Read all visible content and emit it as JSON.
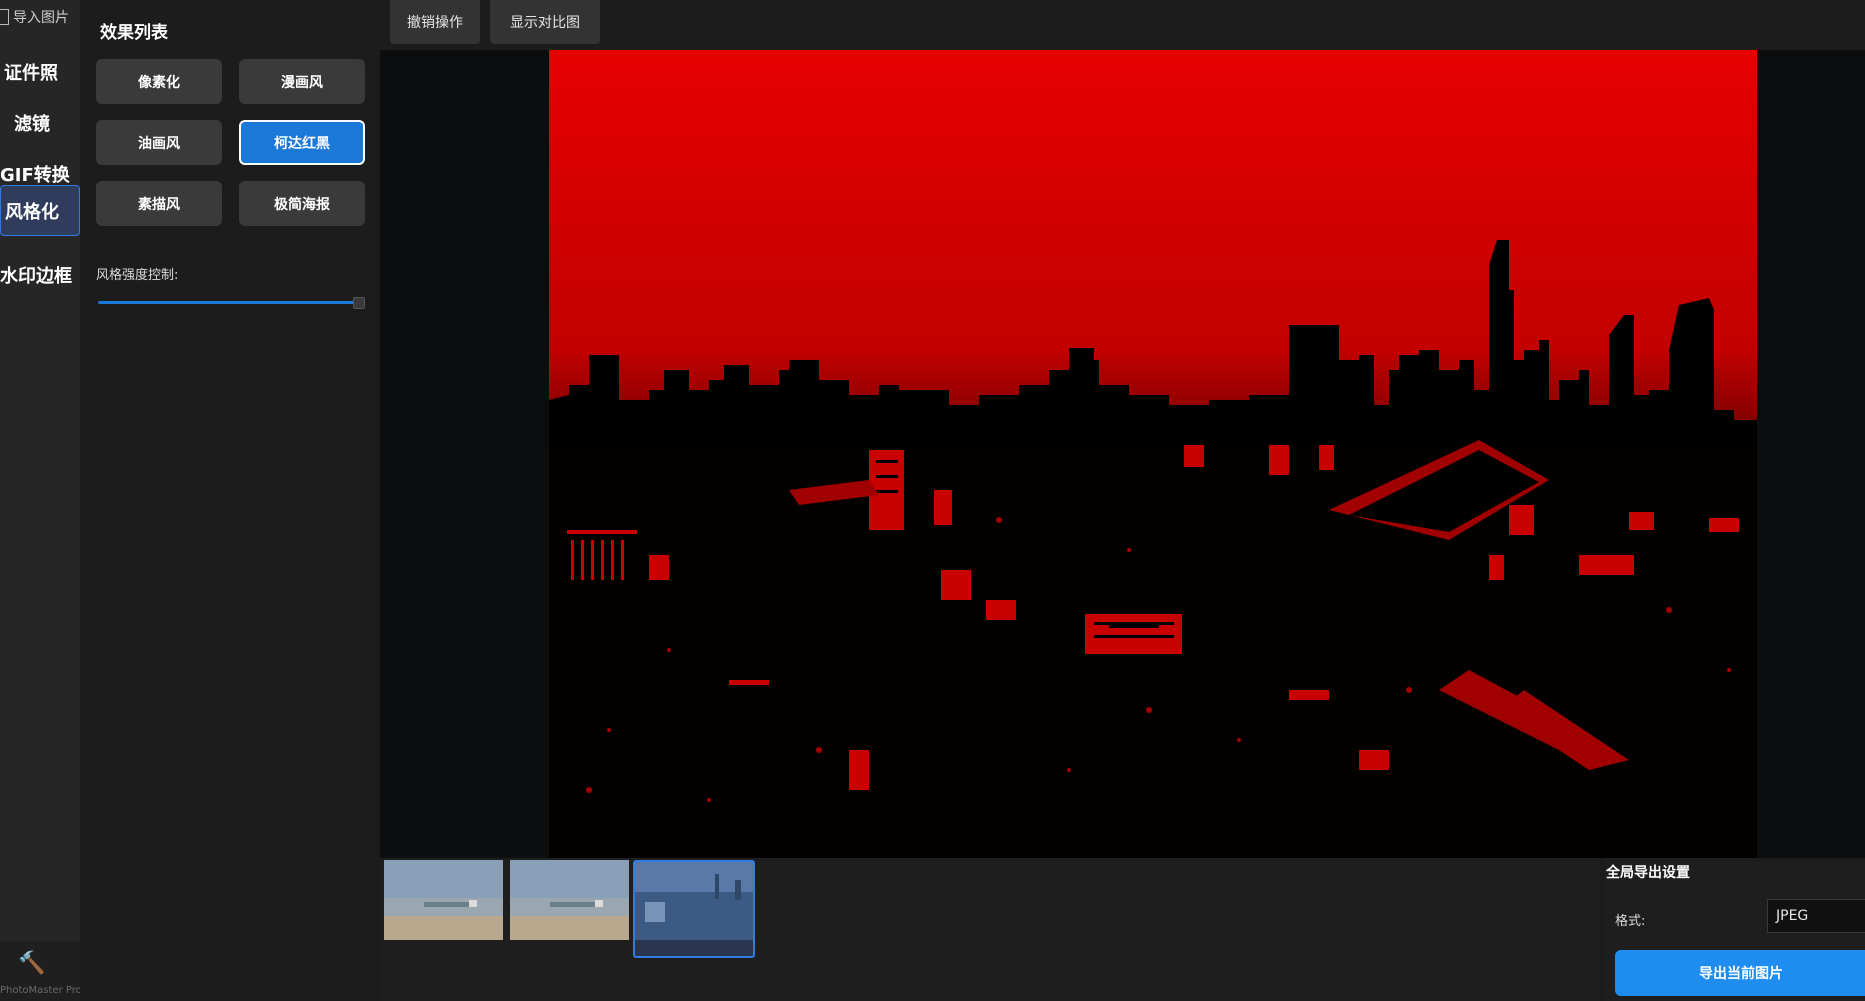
{
  "app": {
    "name": "PhotoMaster Pro"
  },
  "nav": {
    "import_label": "导入图片",
    "items": [
      {
        "label": "证件照",
        "active": false
      },
      {
        "label": "滤镜",
        "active": false
      },
      {
        "label": "GIF转换",
        "active": false
      },
      {
        "label": "风格化",
        "active": true
      },
      {
        "label": "水印边框",
        "active": false
      }
    ]
  },
  "effects": {
    "title": "效果列表",
    "buttons": [
      {
        "label": "像素化",
        "active": false
      },
      {
        "label": "漫画风",
        "active": false
      },
      {
        "label": "油画风",
        "active": false
      },
      {
        "label": "柯达红黑",
        "active": true
      },
      {
        "label": "素描风",
        "active": false
      },
      {
        "label": "极简海报",
        "active": false
      }
    ],
    "strength_label": "风格强度控制:",
    "strength_value": 1.0
  },
  "toolbar": {
    "undo_label": "撤销操作",
    "compare_label": "显示对比图"
  },
  "export": {
    "title": "全局导出设置",
    "format_label": "格式:",
    "format_value": "JPEG",
    "export_label": "导出当前图片"
  },
  "filmstrip": {
    "thumbnails": [
      {
        "subject": "beach-pier",
        "selected": false
      },
      {
        "subject": "beach-pier",
        "selected": false
      },
      {
        "subject": "city-skyline",
        "selected": true
      }
    ]
  },
  "colors": {
    "accent": "#1a78d8",
    "export_button": "#1f8cf0",
    "filter_red": "#e00000"
  }
}
